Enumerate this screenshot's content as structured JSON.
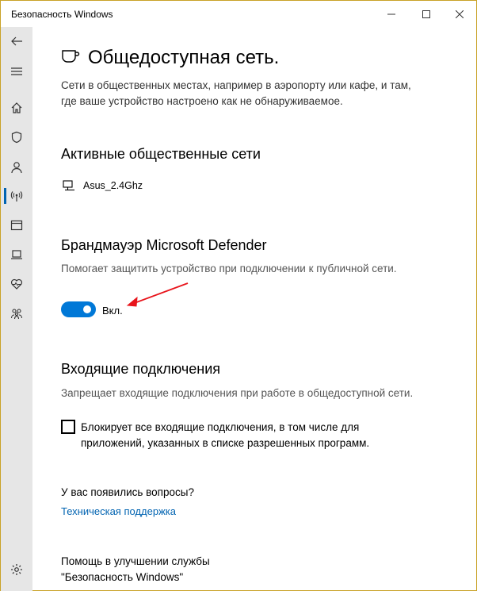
{
  "window": {
    "title": "Безопасность Windows",
    "controls": {
      "minimize": "—",
      "maximize": "☐",
      "close": "✕"
    }
  },
  "sidebar": {
    "items": [
      {
        "icon": "back-arrow-icon"
      },
      {
        "icon": "hamburger-menu-icon"
      },
      {
        "icon": "home-icon"
      },
      {
        "icon": "shield-icon"
      },
      {
        "icon": "person-icon"
      },
      {
        "icon": "wireless-antenna-icon",
        "active": true
      },
      {
        "icon": "app-browser-icon"
      },
      {
        "icon": "laptop-icon"
      },
      {
        "icon": "heart-health-icon"
      },
      {
        "icon": "family-icon"
      },
      {
        "icon": "settings-gear-icon"
      }
    ]
  },
  "page": {
    "title": "Общедоступная сеть.",
    "description": "Сети в общественных местах, например в аэропорту или кафе, и там, где ваше устройство настроено как не обнаруживаемое."
  },
  "active_networks": {
    "heading": "Активные общественные сети",
    "network_name": "Asus_2.4Ghz"
  },
  "firewall": {
    "heading": "Брандмауэр Microsoft Defender",
    "description": "Помогает защитить устройство при подключении к публичной сети.",
    "toggle_state": "on",
    "toggle_label": "Вкл."
  },
  "incoming": {
    "heading": "Входящие подключения",
    "description": "Запрещает входящие подключения при работе в общедоступной сети.",
    "checkbox_checked": false,
    "checkbox_label": "Блокирует все входящие подключения, в том числе для приложений, указанных в списке разрешенных программ."
  },
  "questions": {
    "title": "У вас появились вопросы?",
    "link": "Техническая поддержка"
  },
  "help": {
    "line1": "Помощь в улучшении службы",
    "line2": "\"Безопасность Windows\""
  },
  "colors": {
    "accent": "#0078d7",
    "link": "#0063b1",
    "annotation_arrow": "#e8141b",
    "sidebar_bg": "#e6e6e6",
    "window_border": "#c9a227"
  }
}
